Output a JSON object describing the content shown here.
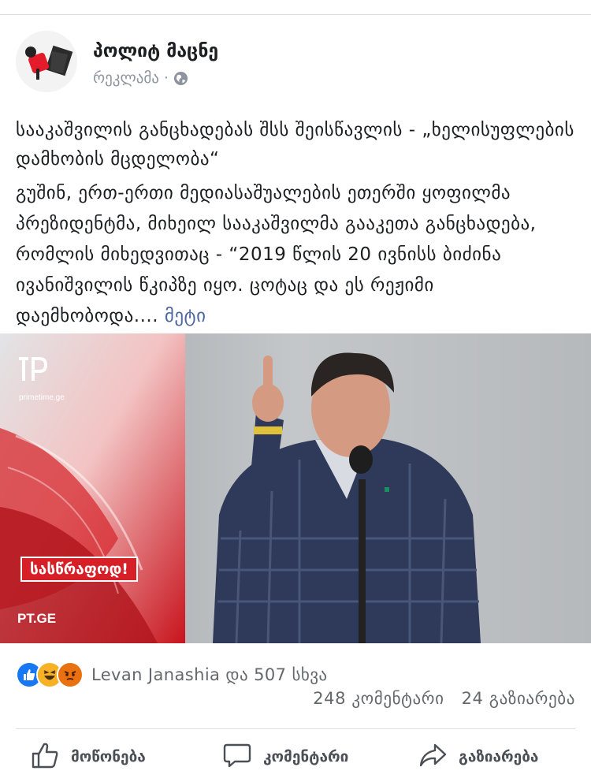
{
  "post": {
    "page_name": "პოლიტ მაცნე",
    "sponsored_label": "რეკლამა",
    "separator": "·",
    "privacy_icon": "globe-icon",
    "title": "სააკაშვილის განცხადებას შსს შეისწავლის - „ხელისუფლების დამხობის მცდელობა“",
    "body": "გუშინ, ერთ-ერთი მედიასაშუალების ეთერში ყოფილმა პრეზიდენტმა, მიხეილ სააკაშვილმა გააკეთა განცხადება, რომლის მიხედვითაც - “2019 წლის 20 ივნისს ბიძინა ივანიშვილის წკიპზე იყო. ცოტაც და ეს რეჟიმი დაემხობოდა.... ",
    "more_label": "მეტი"
  },
  "image": {
    "watermark_site": "primetime.ge",
    "urgent_badge": "სასწრაფოდ!",
    "footer_logo": "PT.GE"
  },
  "reactions": {
    "icons": [
      "like-reaction-icon",
      "haha-reaction-icon",
      "angry-reaction-icon"
    ],
    "summary": "Levan Janashia და 507 სხვა",
    "comments": "248 კომენტარი",
    "shares": "24 გაზიარება"
  },
  "actions": {
    "like_label": "მოწონება",
    "comment_label": "კომენტარი",
    "share_label": "გაზიარება"
  },
  "colors": {
    "link": "#4b67a1",
    "like_blue": "#1877f2",
    "urgent_red": "#d61f26",
    "text": "#1c1e21",
    "muted": "#65676b"
  }
}
